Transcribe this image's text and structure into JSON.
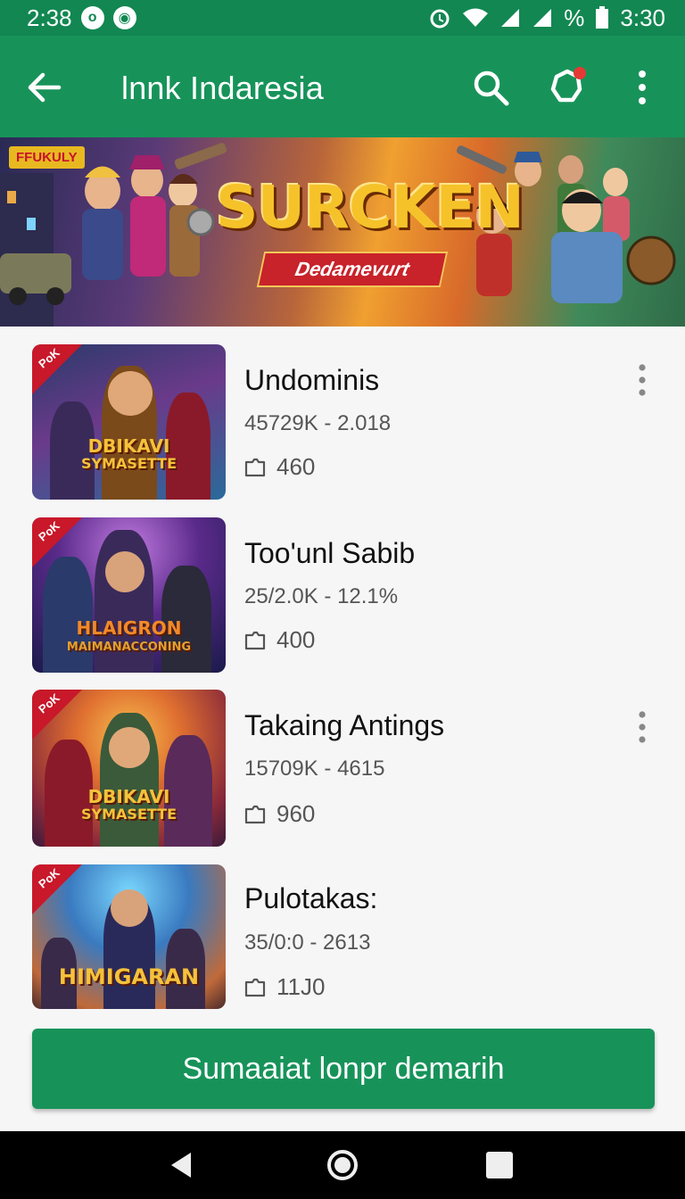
{
  "status_bar": {
    "time_left": "2:38",
    "time_right": "3:30",
    "battery_text": "%"
  },
  "app_bar": {
    "title": "lnnk Indaresia"
  },
  "banner": {
    "tag": "FFUKULY",
    "logo": "SURCKEN",
    "ribbon": "Dedamevurt"
  },
  "items": [
    {
      "name": "Undominis",
      "meta": "45729K - 2.018",
      "count": "460",
      "badge": "PoK",
      "logo_line1": "DBIKAVI",
      "logo_line2": "SYMASETTE",
      "has_menu": true
    },
    {
      "name": "Too'unl Sabib",
      "meta": "25/2.0K - 12.1%",
      "count": "400",
      "badge": "PoK",
      "logo_line1": "HLAIGRON",
      "logo_line2": "MAIMANACCONING",
      "has_menu": false
    },
    {
      "name": "Takaing Antings",
      "meta": "15709K - 4615",
      "count": "960",
      "badge": "PoK",
      "logo_line1": "DBIKAVI",
      "logo_line2": "SYMASETTE",
      "has_menu": true
    },
    {
      "name": "Pulotakas:",
      "meta": "35/0:0 - 2613",
      "count": "11J0",
      "badge": "PoK",
      "logo_line1": "HIMIGARAN",
      "logo_line2": "",
      "has_menu": false
    }
  ],
  "cta": {
    "label": "Sumaaiat lonpr demarih"
  },
  "colors": {
    "primary": "#17935a",
    "primary_dark": "#128752",
    "notification_dot": "#e53935"
  }
}
